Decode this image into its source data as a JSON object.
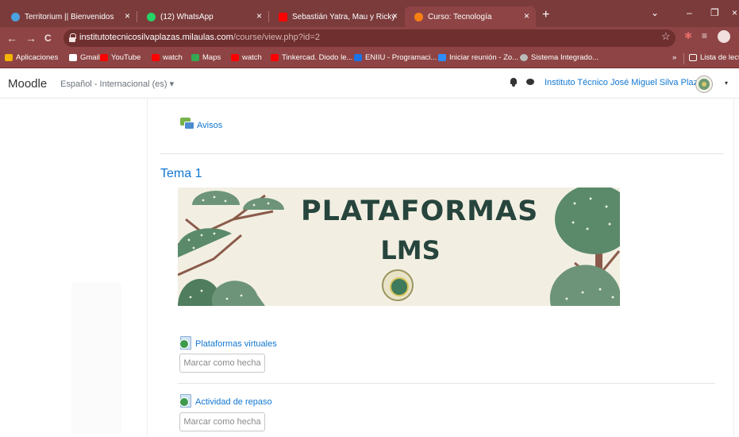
{
  "browser": {
    "tabs": [
      {
        "title": "Territorium || Bienvenidos",
        "close": "×"
      },
      {
        "title": "(12) WhatsApp",
        "close": "×"
      },
      {
        "title": "Sebastián Yatra, Mau y Ricky",
        "close": "×"
      },
      {
        "title": "Curso: Tecnología",
        "close": "×"
      }
    ],
    "new_tab": "+",
    "window_controls": {
      "dropdown": "⌄",
      "minimize": "–",
      "maximize": "❐",
      "close": "×"
    },
    "nav": {
      "back": "←",
      "forward": "→",
      "reload": "C"
    },
    "url_host": "institutotecnicosilvaplazas.milaulas.com",
    "url_path": "/course/view.php?id=2",
    "bookmark_star": "☆",
    "extensions": [
      "✱",
      "≡"
    ],
    "bookmarks": [
      "Aplicaciones",
      "Gmail",
      "YouTube",
      "watch",
      "Maps",
      "watch",
      "Tinkercad. Diodo le...",
      "ENIIU - Programaci...",
      "Iniciar reunión - Zo...",
      "Sistema Integrado..."
    ],
    "bookmarks_overflow": "»",
    "reading_list": "Lista de lectu"
  },
  "moodle": {
    "brand": "Moodle",
    "language": "Español - Internacional (es) ▾",
    "user_name": "Instituto Técnico José Miguel Silva Plazas",
    "user_caret": "▾"
  },
  "course": {
    "avisos": "Avisos",
    "section_title": "Tema 1",
    "banner": {
      "line1": "PLATAFORMAS",
      "line2": "LMS"
    },
    "activities": [
      {
        "name": "Plataformas virtuales",
        "button": "Marcar como hecha"
      },
      {
        "name": "Actividad de repaso",
        "button": "Marcar como hecha"
      }
    ]
  },
  "colors": {
    "browser_frame": "#8e4444",
    "moodle_link": "#1177d1",
    "banner_text": "#27453d",
    "tree_green": "#5b8a6a",
    "branch": "#8b5a4a"
  }
}
